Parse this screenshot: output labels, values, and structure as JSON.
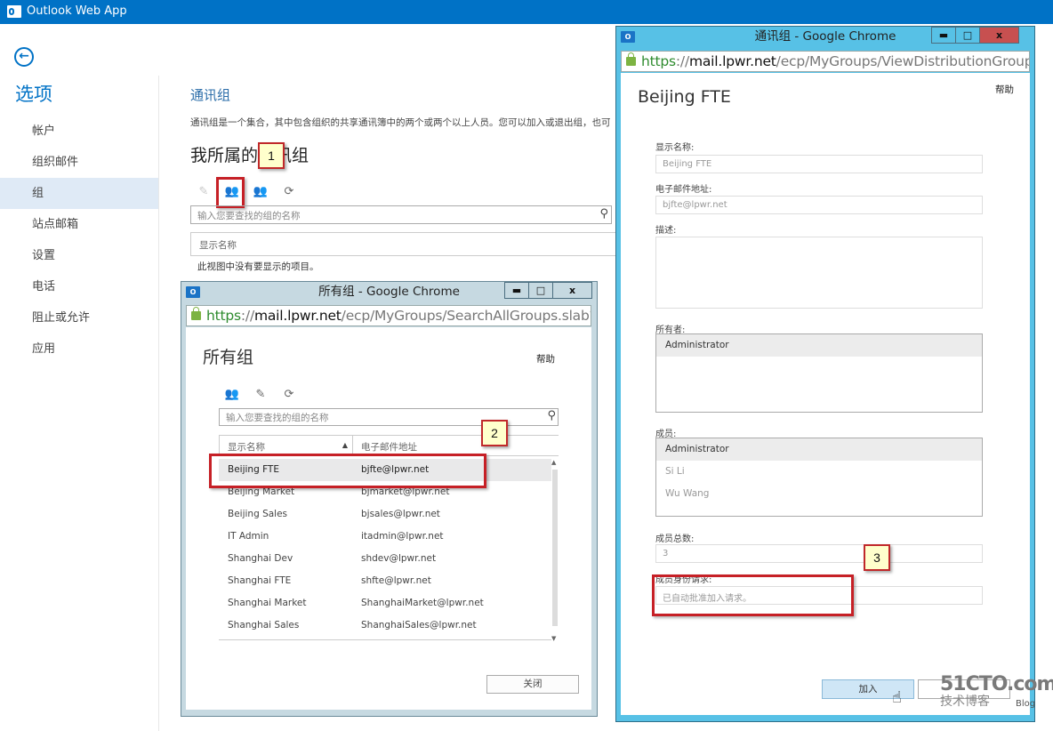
{
  "app": {
    "title": "Outlook Web App",
    "logo_icon": "outlook-icon",
    "back_icon": "back-arrow-icon"
  },
  "nav": {
    "title": "选项",
    "items": [
      {
        "label": "帐户",
        "active": false
      },
      {
        "label": "组织邮件",
        "active": false
      },
      {
        "label": "组",
        "active": true
      },
      {
        "label": "站点邮箱",
        "active": false
      },
      {
        "label": "设置",
        "active": false
      },
      {
        "label": "电话",
        "active": false
      },
      {
        "label": "阻止或允许",
        "active": false
      },
      {
        "label": "应用",
        "active": false
      }
    ]
  },
  "main": {
    "title": "通讯组",
    "description": "通讯组是一个集合，其中包含组织的共享通讯簿中的两个或两个以上人员。您可以加入或退出组，也可",
    "section_title": "我所属的通讯组",
    "toolbar": [
      {
        "icon": "edit-pencil-icon",
        "enabled": false
      },
      {
        "icon": "join-group-icon",
        "enabled": true
      },
      {
        "icon": "leave-group-icon",
        "enabled": true
      },
      {
        "icon": "refresh-icon",
        "enabled": true
      }
    ],
    "search_placeholder": "输入您要查找的组的名称",
    "column_header": "显示名称",
    "empty_message": "此视图中没有要显示的项目。"
  },
  "callouts": {
    "one": "1",
    "two": "2",
    "three": "3"
  },
  "all_groups_window": {
    "window_title": "所有组 - Google Chrome",
    "url": {
      "scheme": "https",
      "sep": "://",
      "host": "mail.lpwr.net",
      "path": "/ecp/MyGroups/SearchAllGroups.slab?pwn"
    },
    "title": "所有组",
    "help": "帮助",
    "toolbar": [
      "join-group-icon",
      "edit-pencil-icon",
      "refresh-icon"
    ],
    "search_placeholder": "输入您要查找的组的名称",
    "columns": {
      "name": "显示名称",
      "email": "电子邮件地址",
      "sort": "▲"
    },
    "rows": [
      {
        "name": "Beijing FTE",
        "email": "bjfte@lpwr.net",
        "selected": true
      },
      {
        "name": "Beijing Market",
        "email": "bjmarket@lpwr.net",
        "selected": false
      },
      {
        "name": "Beijing Sales",
        "email": "bjsales@lpwr.net",
        "selected": false
      },
      {
        "name": "IT Admin",
        "email": "itadmin@lpwr.net",
        "selected": false
      },
      {
        "name": "Shanghai Dev",
        "email": "shdev@lpwr.net",
        "selected": false
      },
      {
        "name": "Shanghai FTE",
        "email": "shfte@lpwr.net",
        "selected": false
      },
      {
        "name": "Shanghai Market",
        "email": "ShanghaiMarket@lpwr.net",
        "selected": false
      },
      {
        "name": "Shanghai Sales",
        "email": "ShanghaiSales@lpwr.net",
        "selected": false
      }
    ],
    "close_button": "关闭"
  },
  "group_window": {
    "window_title": "通讯组 - Google Chrome",
    "url": {
      "scheme": "https",
      "sep": "://",
      "host": "mail.lpwr.net",
      "path": "/ecp/MyGroups/ViewDistributionGroup.asp"
    },
    "title": "Beijing FTE",
    "help": "帮助",
    "display_name_label": "显示名称:",
    "display_name": "Beijing FTE",
    "email_label": "电子邮件地址:",
    "email": "bjfte@lpwr.net",
    "description_label": "描述:",
    "description": "",
    "owners_label": "所有者:",
    "owners": [
      "Administrator"
    ],
    "members_label": "成员:",
    "members": [
      "Administrator",
      "Si Li",
      "Wu Wang"
    ],
    "member_count_label": "成员总数:",
    "member_count": "3",
    "membership_request_label": "成员身份请求:",
    "membership_request": "已自动批准加入请求。",
    "join_button": "加入"
  },
  "window_controls": {
    "minimize": "▬",
    "maximize": "□",
    "close": "x"
  },
  "watermark": {
    "line1": "51CTO.com",
    "line2": "技术博客",
    "line3": "Blog"
  }
}
